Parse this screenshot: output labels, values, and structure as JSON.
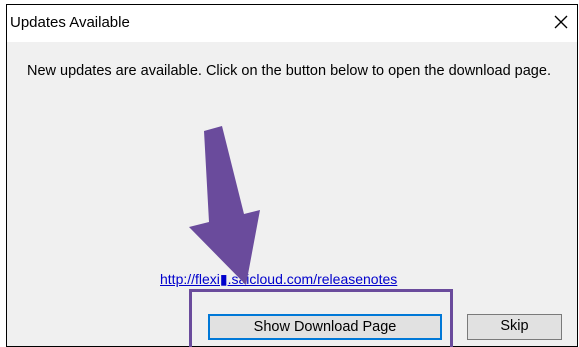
{
  "dialog": {
    "title": "Updates Available",
    "close_glyph": "✕",
    "message": "New updates are available. Click on the button below to open the download page.",
    "link_text": "http://flexi▮.saicloud.com/releasenotes",
    "primary_button": "Show Download Page",
    "secondary_button": "Skip"
  },
  "annotation": {
    "color": "#6a4b9c",
    "shape": "arrow-and-highlight-box"
  }
}
